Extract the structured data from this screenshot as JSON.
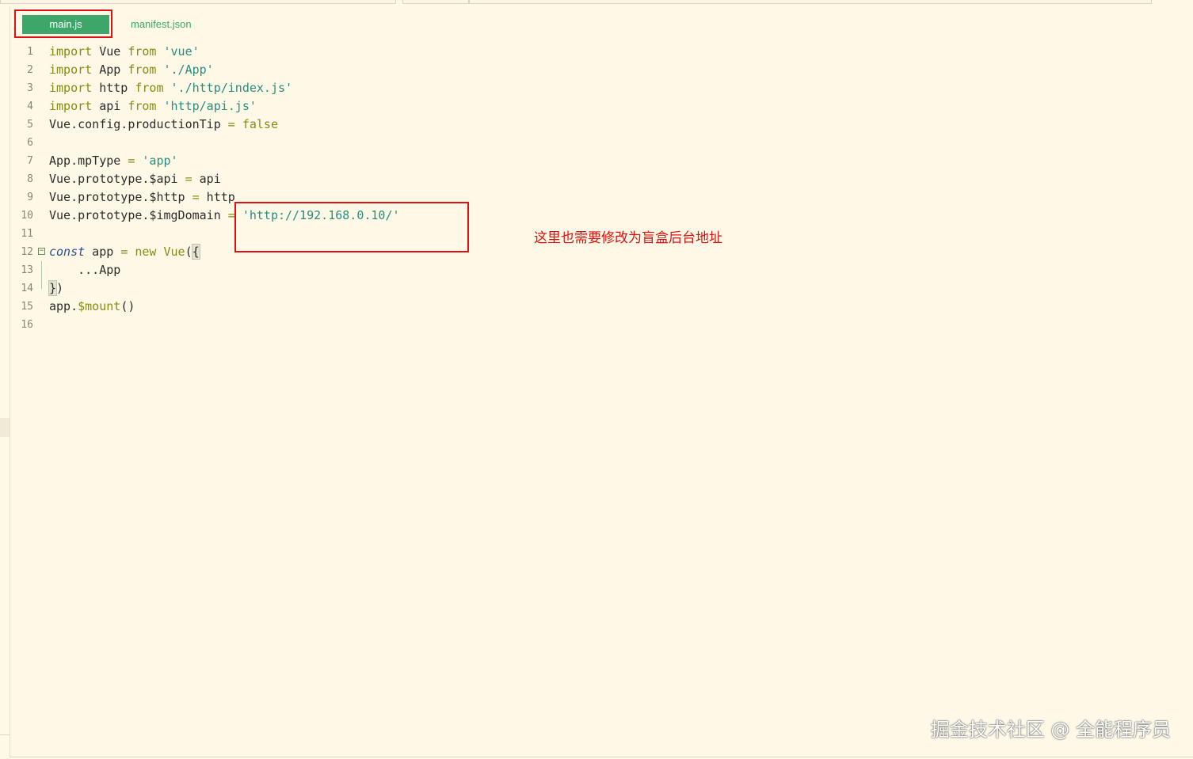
{
  "tabs": {
    "active_label": "main.js",
    "inactive_label": "manifest.json"
  },
  "code_lines": [
    {
      "num": "1",
      "tokens": [
        [
          "kw",
          "import"
        ],
        [
          "",
          "Vue "
        ],
        [
          "kw",
          "from"
        ],
        [
          "",
          " "
        ],
        [
          "str",
          "'vue'"
        ]
      ]
    },
    {
      "num": "2",
      "tokens": [
        [
          "kw",
          "import"
        ],
        [
          "",
          "App "
        ],
        [
          "kw",
          "from"
        ],
        [
          "",
          " "
        ],
        [
          "str",
          "'./App'"
        ]
      ]
    },
    {
      "num": "3",
      "tokens": [
        [
          "kw",
          "import"
        ],
        [
          "",
          "http "
        ],
        [
          "kw",
          "from"
        ],
        [
          "",
          " "
        ],
        [
          "str",
          "'./http/index.js'"
        ]
      ]
    },
    {
      "num": "4",
      "tokens": [
        [
          "kw",
          "import"
        ],
        [
          "",
          "api "
        ],
        [
          "kw",
          "from"
        ],
        [
          "",
          " "
        ],
        [
          "str",
          "'http/api.js'"
        ]
      ]
    },
    {
      "num": "5",
      "tokens": [
        [
          "",
          "Vue.config.productionTip "
        ],
        [
          "op",
          "="
        ],
        [
          "",
          " "
        ],
        [
          "kw",
          "false"
        ]
      ]
    },
    {
      "num": "6",
      "tokens": []
    },
    {
      "num": "7",
      "tokens": [
        [
          "",
          "App.mpType "
        ],
        [
          "op",
          "="
        ],
        [
          "",
          " "
        ],
        [
          "str",
          "'app'"
        ]
      ]
    },
    {
      "num": "8",
      "tokens": [
        [
          "",
          "Vue.prototype.$api "
        ],
        [
          "op",
          "="
        ],
        [
          "",
          " api"
        ]
      ]
    },
    {
      "num": "9",
      "tokens": [
        [
          "",
          "Vue.prototype.$http "
        ],
        [
          "op",
          "="
        ],
        [
          "",
          " http"
        ]
      ]
    },
    {
      "num": "10",
      "tokens": [
        [
          "",
          "Vue.prototype.$imgDomain "
        ],
        [
          "op",
          "="
        ],
        [
          "",
          " "
        ],
        [
          "str",
          "'http://192.168.0.10/'"
        ]
      ]
    },
    {
      "num": "11",
      "tokens": []
    },
    {
      "num": "12",
      "tokens": [
        [
          "const-kw",
          "const"
        ],
        [
          "",
          " app "
        ],
        [
          "op",
          "="
        ],
        [
          "",
          " "
        ],
        [
          "kw",
          "new"
        ],
        [
          "",
          " "
        ],
        [
          "fn",
          "Vue"
        ],
        [
          "",
          "("
        ],
        [
          "brace-hl",
          "{"
        ]
      ]
    },
    {
      "num": "13",
      "tokens": [
        [
          "",
          "    ...App"
        ]
      ]
    },
    {
      "num": "14",
      "tokens": [
        [
          "brace-hl",
          "}"
        ],
        [
          "",
          ")"
        ]
      ]
    },
    {
      "num": "15",
      "tokens": [
        [
          "",
          "app."
        ],
        [
          "fn",
          "$mount"
        ],
        [
          "",
          "()"
        ]
      ]
    },
    {
      "num": "16",
      "tokens": []
    }
  ],
  "annotation": {
    "note": "这里也需要修改为盲盒后台地址",
    "color": "#e01010"
  },
  "watermark": "掘金技术社区 @ 全能程序员",
  "colors": {
    "background": "#fdf9e6",
    "tab_active": "#3fa66a",
    "keyword": "#8a8a12",
    "string": "#2a8c80"
  }
}
